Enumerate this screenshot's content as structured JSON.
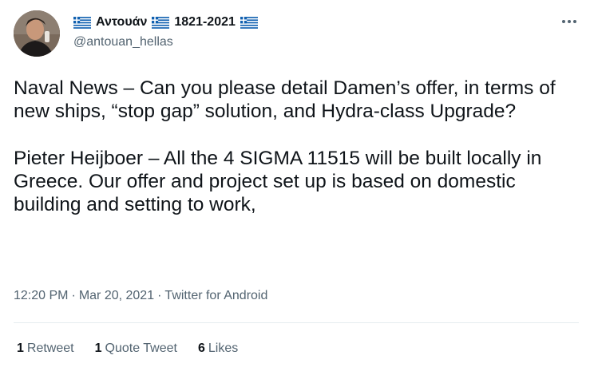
{
  "author": {
    "display_name": "Αντουάν",
    "years": "1821-2021",
    "handle": "@antouan_hellas",
    "flag_icon": "greek-flag-icon",
    "flag_colors": {
      "blue": "#0d5eaf",
      "white": "#ffffff"
    }
  },
  "menu": {
    "icon": "more-horizontal-icon"
  },
  "tweet": {
    "paragraphs": [
      "Naval News – Can you please detail Damen’s offer, in terms of new ships, “stop gap” solution, and Hydra-class Upgrade?",
      "Pieter Heijboer – All the 4 SIGMA 11515 will be built locally in Greece. Our offer and project set up is based on domestic building and setting to work,"
    ]
  },
  "meta": {
    "time": "12:20 PM",
    "separator": "·",
    "date": "Mar 20, 2021",
    "source": "Twitter for Android"
  },
  "stats": {
    "retweets": {
      "count": "1",
      "label": "Retweet"
    },
    "quotes": {
      "count": "1",
      "label": "Quote Tweet"
    },
    "likes": {
      "count": "6",
      "label": "Likes"
    }
  }
}
